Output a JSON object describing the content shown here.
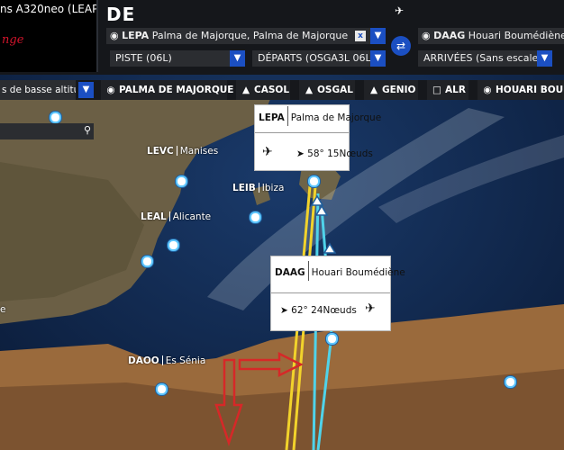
{
  "aircraft": "ns A320neo (LEAP)",
  "logo_text": "nge",
  "header": {
    "title": "DE"
  },
  "departure": {
    "code": "LEPA",
    "name": "Palma de Majorque, Palma de Majorque",
    "clear": "x"
  },
  "arrival": {
    "code": "DAAG",
    "name": "Houari Boumédiène, Alg"
  },
  "runway_select": "PISTE (06L)",
  "departures_select": "DÉPARTS (OSGA3L 06L)",
  "arrivals_select": "ARRIVÉES (Sans escale)",
  "filter": {
    "altitude_select": "s de basse altitud",
    "waypoints": [
      "PALMA DE MAJORQUE",
      "CASOL",
      "OSGAL",
      "GENIO",
      "ALR",
      "HOUARI BOUME"
    ]
  },
  "map_labels": [
    {
      "code": "LEVC",
      "name": "Manises"
    },
    {
      "code": "LEIB",
      "name": "Ibiza"
    },
    {
      "code": "LEAL",
      "name": "Alicante"
    },
    {
      "code": "DAOO",
      "name": "Es Sénia"
    }
  ],
  "partial_label": "e",
  "cards": {
    "lepa": {
      "code": "LEPA",
      "name": "Palma de Majorque",
      "wind": "58° 15Nœuds"
    },
    "daag": {
      "code": "DAAG",
      "name": "Houari Boumédiène",
      "wind": "62° 24Nœuds"
    }
  },
  "colors": {
    "accent": "#1b4fc2",
    "route_yellow": "#f2d32b",
    "route_cyan": "#4fd3ea",
    "annotation_red": "#d62828"
  },
  "icons": [
    "search-icon",
    "waypoint-icon",
    "chevron-down-icon",
    "swap-icon",
    "departure-plane-icon",
    "arrival-plane-icon",
    "wind-icon",
    "airport-icon",
    "plane-icon"
  ]
}
